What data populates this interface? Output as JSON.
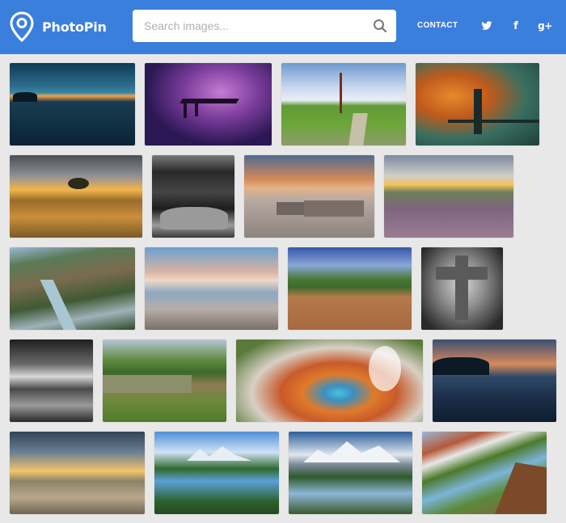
{
  "app": {
    "name": "PhotoPin",
    "brand_color": "#3b7fdd"
  },
  "header": {
    "logo_icon": "map-pin-icon",
    "search": {
      "placeholder": "Search images...",
      "value": "",
      "icon": "search-icon"
    },
    "nav": {
      "contact_label": "CONTACT"
    },
    "social": [
      {
        "name": "twitter",
        "icon": "twitter-icon",
        "glyph": ""
      },
      {
        "name": "facebook",
        "icon": "facebook-icon",
        "glyph": "f"
      },
      {
        "name": "google-plus",
        "icon": "google-plus-icon",
        "glyph": "g+"
      }
    ]
  },
  "gallery": {
    "rows": 5,
    "photos": [
      {
        "id": 1,
        "subject": "lake-sunset"
      },
      {
        "id": 2,
        "subject": "purple-pier"
      },
      {
        "id": 3,
        "subject": "marsh-landscape"
      },
      {
        "id": 4,
        "subject": "bridge-sunset"
      },
      {
        "id": 5,
        "subject": "golden-field"
      },
      {
        "id": 6,
        "subject": "bw-seascape"
      },
      {
        "id": 7,
        "subject": "beach-rocks"
      },
      {
        "id": 8,
        "subject": "heather-field"
      },
      {
        "id": 9,
        "subject": "canyon-river"
      },
      {
        "id": 10,
        "subject": "beach-reflection"
      },
      {
        "id": 11,
        "subject": "red-earth"
      },
      {
        "id": 12,
        "subject": "stone-cross"
      },
      {
        "id": 13,
        "subject": "bw-rocks"
      },
      {
        "id": 14,
        "subject": "river-grass"
      },
      {
        "id": 15,
        "subject": "geyser-pool"
      },
      {
        "id": 16,
        "subject": "lake-dusk"
      },
      {
        "id": 17,
        "subject": "meadow-sunset"
      },
      {
        "id": 18,
        "subject": "mountain-lake"
      },
      {
        "id": 19,
        "subject": "snowy-peaks"
      },
      {
        "id": 20,
        "subject": "coast-cliff"
      }
    ]
  }
}
